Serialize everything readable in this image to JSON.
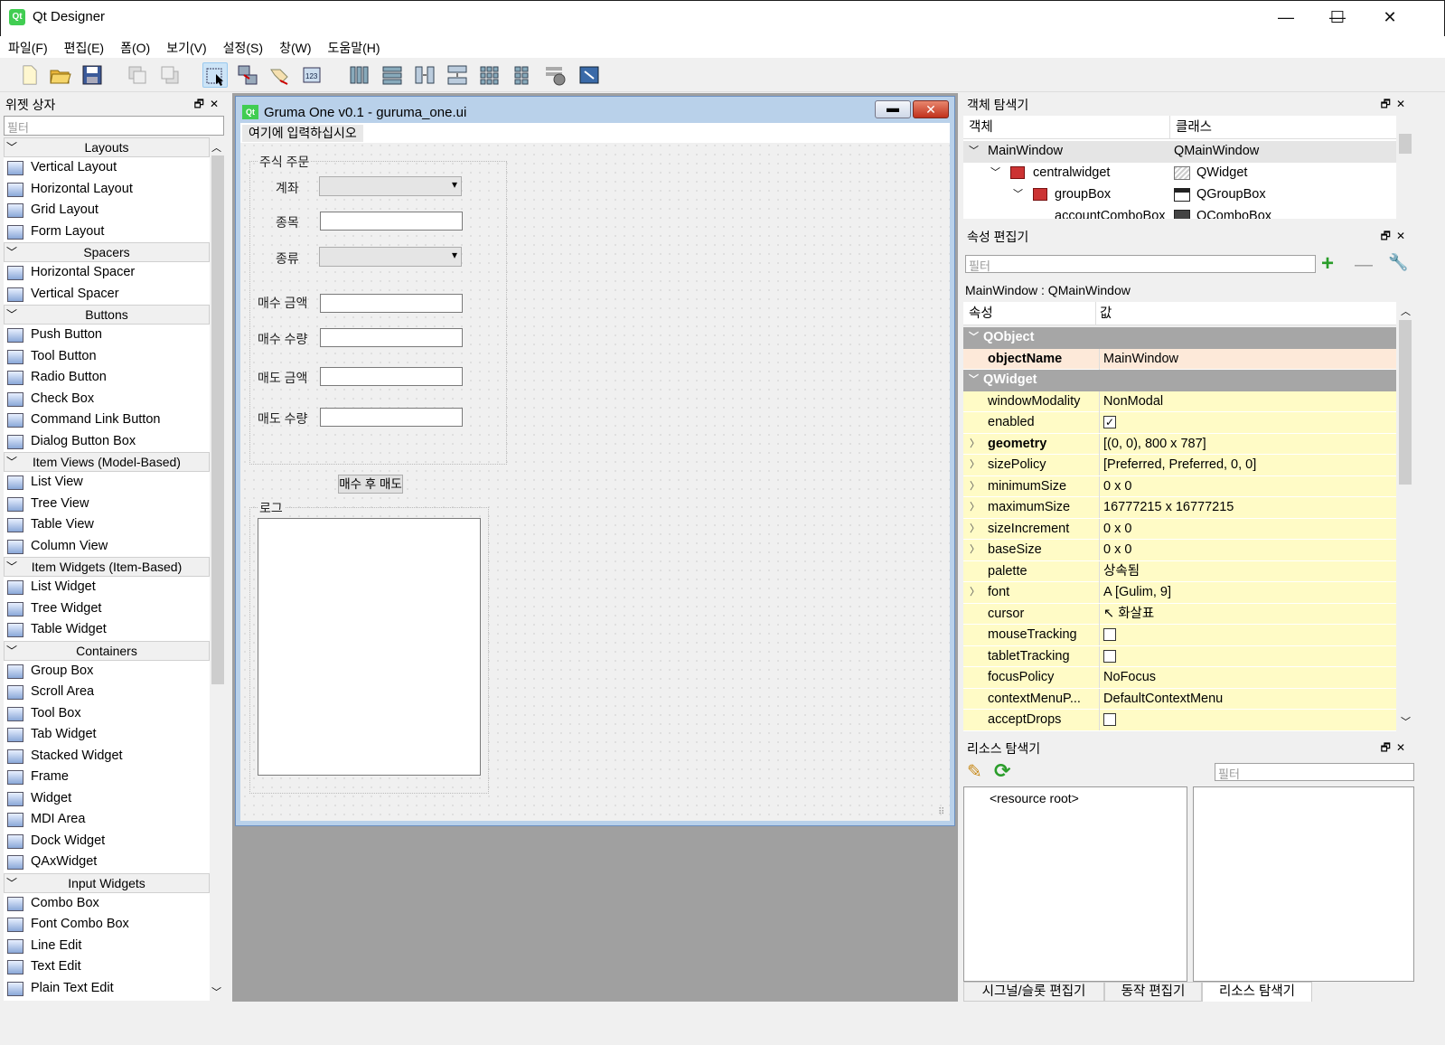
{
  "window": {
    "title": "Qt Designer",
    "minimize": "—",
    "maximize": "☐",
    "close": "✕"
  },
  "menubar": [
    "파일(F)",
    "편집(E)",
    "폼(O)",
    "보기(V)",
    "설정(S)",
    "창(W)",
    "도움말(H)"
  ],
  "widget_box": {
    "title": "위젯 상자",
    "filter_placeholder": "필터",
    "categories": [
      {
        "name": "Layouts",
        "items": [
          "Vertical Layout",
          "Horizontal Layout",
          "Grid Layout",
          "Form Layout"
        ]
      },
      {
        "name": "Spacers",
        "items": [
          "Horizontal Spacer",
          "Vertical Spacer"
        ]
      },
      {
        "name": "Buttons",
        "items": [
          "Push Button",
          "Tool Button",
          "Radio Button",
          "Check Box",
          "Command Link Button",
          "Dialog Button Box"
        ]
      },
      {
        "name": "Item Views (Model-Based)",
        "items": [
          "List View",
          "Tree View",
          "Table View",
          "Column View"
        ]
      },
      {
        "name": "Item Widgets (Item-Based)",
        "items": [
          "List Widget",
          "Tree Widget",
          "Table Widget"
        ]
      },
      {
        "name": "Containers",
        "items": [
          "Group Box",
          "Scroll Area",
          "Tool Box",
          "Tab Widget",
          "Stacked Widget",
          "Frame",
          "Widget",
          "MDI Area",
          "Dock Widget",
          "QAxWidget"
        ]
      },
      {
        "name": "Input Widgets",
        "items": [
          "Combo Box",
          "Font Combo Box",
          "Line Edit",
          "Text Edit",
          "Plain Text Edit"
        ]
      }
    ]
  },
  "form": {
    "title": "Gruma One v0.1 - guruma_one.ui",
    "menu_placeholder": "여기에 입력하십시오",
    "order_group": "주식 주문",
    "labels": {
      "account": "계좌",
      "stock": "종목",
      "type": "종류",
      "buy_amount": "매수 금액",
      "buy_qty": "매수 수량",
      "sell_amount": "매도 금액",
      "sell_qty": "매도 수량"
    },
    "run_button": "매수 후 매도",
    "log_group": "로그"
  },
  "object_inspector": {
    "title": "객체 탐색기",
    "headers": [
      "객체",
      "클래스"
    ],
    "rows": [
      {
        "object": "MainWindow",
        "class": "QMainWindow"
      },
      {
        "object": "centralwidget",
        "class": "QWidget"
      },
      {
        "object": "groupBox",
        "class": "QGroupBox"
      },
      {
        "object": "accountComboBox",
        "class": "QComboBox"
      }
    ]
  },
  "property_editor": {
    "title": "속성 편집기",
    "filter_placeholder": "필터",
    "context": "MainWindow : QMainWindow",
    "headers": [
      "속성",
      "값"
    ],
    "sections": [
      {
        "name": "QObject",
        "props": [
          {
            "name": "objectName",
            "value": "MainWindow",
            "bold": true
          }
        ]
      },
      {
        "name": "QWidget",
        "props": [
          {
            "name": "windowModality",
            "value": "NonModal"
          },
          {
            "name": "enabled",
            "value": "",
            "check": true
          },
          {
            "name": "geometry",
            "value": "[(0, 0), 800 x 787]",
            "bold": true,
            "expand": true
          },
          {
            "name": "sizePolicy",
            "value": "[Preferred, Preferred, 0, 0]",
            "expand": true
          },
          {
            "name": "minimumSize",
            "value": "0 x 0",
            "expand": true
          },
          {
            "name": "maximumSize",
            "value": "16777215 x 16777215",
            "expand": true
          },
          {
            "name": "sizeIncrement",
            "value": "0 x 0",
            "expand": true
          },
          {
            "name": "baseSize",
            "value": "0 x 0",
            "expand": true
          },
          {
            "name": "palette",
            "value": "상속됨"
          },
          {
            "name": "font",
            "value": "[Gulim, 9]",
            "expand": true,
            "icon": "font-icon"
          },
          {
            "name": "cursor",
            "value": "화살표",
            "icon": "arrow-cursor-icon"
          },
          {
            "name": "mouseTracking",
            "value": "",
            "check": false
          },
          {
            "name": "tabletTracking",
            "value": "",
            "check": false
          },
          {
            "name": "focusPolicy",
            "value": "NoFocus"
          },
          {
            "name": "contextMenuP...",
            "value": "DefaultContextMenu"
          },
          {
            "name": "acceptDrops",
            "value": "",
            "check": false
          }
        ]
      }
    ]
  },
  "resource_browser": {
    "title": "리소스 탐색기",
    "filter_placeholder": "필터",
    "root": "<resource root>"
  },
  "bottom_tabs": [
    "시그널/슬롯 편집기",
    "동작 편집기",
    "리소스 탐색기"
  ],
  "colors": {
    "property_row": "#fffbc6",
    "section_header": "#a6a6a6",
    "selection": "#cce4f7"
  }
}
